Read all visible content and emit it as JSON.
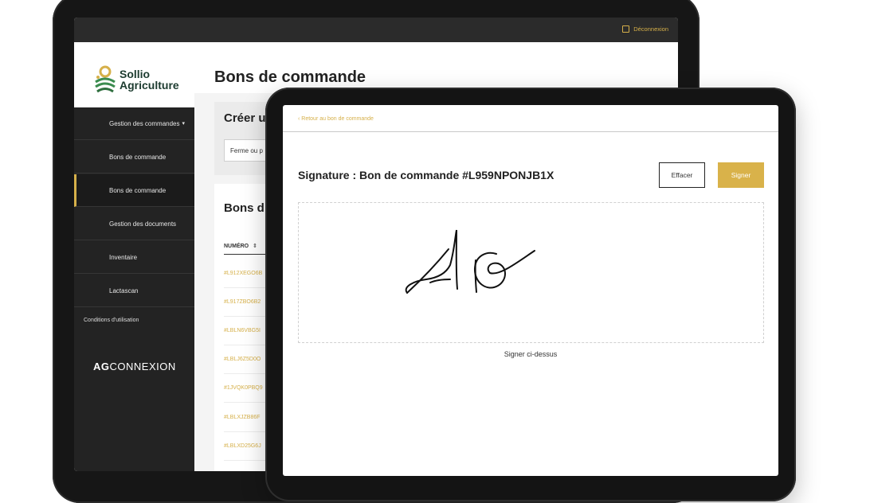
{
  "back_tablet": {
    "topbar": {
      "logout_label": "Déconnexion",
      "logout_icon": "logout-icon"
    },
    "brand": {
      "line1": "Sollio",
      "line2": "Agriculture",
      "logo_icon": "sollio-leaf-logo"
    },
    "sidebar": {
      "items": [
        {
          "label": "Gestion des commandes",
          "caret": "▾"
        },
        {
          "label": "Bons de commande"
        },
        {
          "label": "Bons de commande"
        },
        {
          "label": "Gestion des documents"
        },
        {
          "label": "Inventaire"
        },
        {
          "label": "Lactascan"
        }
      ],
      "terms": "Conditions d'utilisation",
      "footer_brand_bold": "AG",
      "footer_brand_rest": "CONNEXION"
    },
    "main": {
      "title": "Bons de commande",
      "create_section_title": "Créer u",
      "farm_input_value": "Ferme ou p",
      "list_title": "Bons d",
      "column_header": "NUMÉRO",
      "sort_icon": "⇕",
      "rows": [
        "#L912XEGO6B",
        "#L917ZBO6B2",
        "#LBLN6VBG5I",
        "#LBLJ6Z5D0O",
        "#1JVQK0PBQ9",
        "#LBLXJZB86F",
        "#LBLXD25G6J"
      ]
    }
  },
  "front_tablet": {
    "back_link": "‹ Retour au bon de commande",
    "title": "Signature : Bon de commande #L959NPONJB1X",
    "clear_button": "Effacer",
    "sign_button": "Signer",
    "caption": "Signer ci-dessus",
    "signature_image": "handwritten-signature-AG"
  },
  "colors": {
    "accent": "#d6b04a",
    "sidebar": "#232323",
    "topbar": "#2b2b2b"
  }
}
